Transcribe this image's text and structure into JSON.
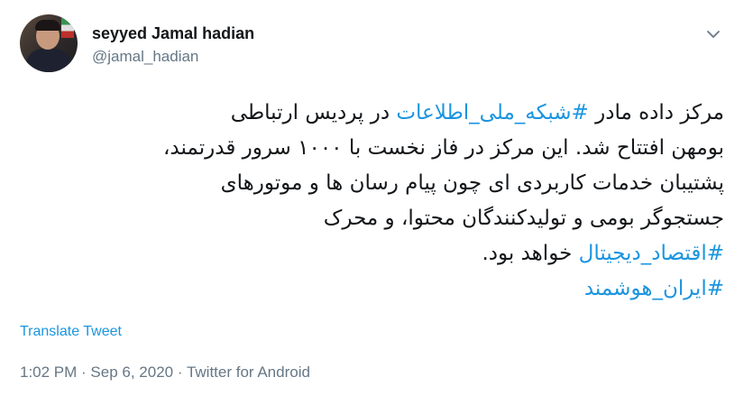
{
  "author": {
    "name": "seyyed Jamal hadian",
    "handle": "@jamal_hadian"
  },
  "tweet": {
    "line1": {
      "before": "مرکز داده مادر ",
      "hashtag": "#شبکه_ملی_اطلاعات",
      "after": " در پردیس ارتباطی"
    },
    "line2": "بومهن افتتاح شد. این مرکز در فاز نخست با ۱۰۰۰ سرور قدرتمند،",
    "line3": "پشتیبان خدمات کاربردی ای چون پیام رسان ها و موتورهای",
    "line4": "جستجوگر بومی و تولیدکنندگان محتوا، و محرک",
    "line5": {
      "hashtag": "#اقتصاد_دیجیتال",
      "after": " خواهد بود."
    },
    "line6": {
      "hashtag": "#ایران_هوشمند"
    }
  },
  "translate_label": "Translate Tweet",
  "meta": {
    "time": "1:02 PM",
    "sep1": " · ",
    "date": "Sep 6, 2020",
    "sep2": " · ",
    "source": "Twitter for Android"
  },
  "icons": {
    "menu": "chevron-down-icon"
  },
  "colors": {
    "link": "#1b95e0",
    "muted": "#657786",
    "text": "#14171a"
  }
}
